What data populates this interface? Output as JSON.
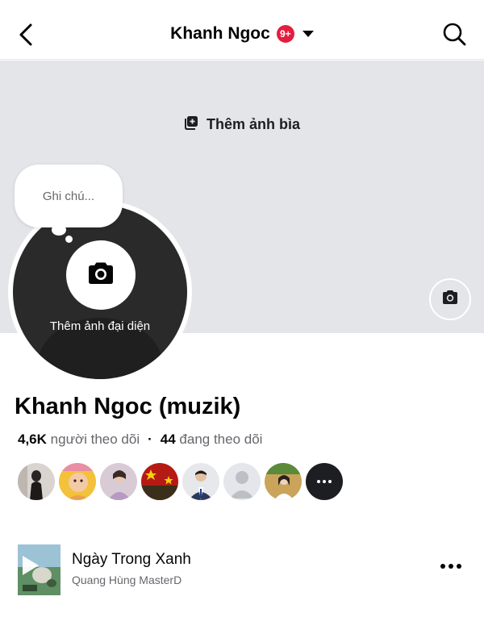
{
  "header": {
    "title": "Khanh Ngoc",
    "notification_badge": "9+"
  },
  "cover": {
    "add_cover_label": "Thêm ảnh bìa"
  },
  "avatar": {
    "add_avatar_label": "Thêm ảnh đại diện"
  },
  "note": {
    "placeholder": "Ghi chú..."
  },
  "profile": {
    "name": "Khanh Ngoc (muzik)",
    "followers_count": "4,6K",
    "followers_label": "người theo dõi",
    "following_count": "44",
    "following_label": "đang theo dõi"
  },
  "friends": {
    "count_shown": 7,
    "has_more": true
  },
  "music": {
    "song_title": "Ngày Trong Xanh",
    "artist": "Quang Hùng MasterD"
  },
  "colors": {
    "badge_red": "#e41e3f",
    "cover_gray": "#e3e5e9",
    "secondary_text": "#65676b"
  }
}
